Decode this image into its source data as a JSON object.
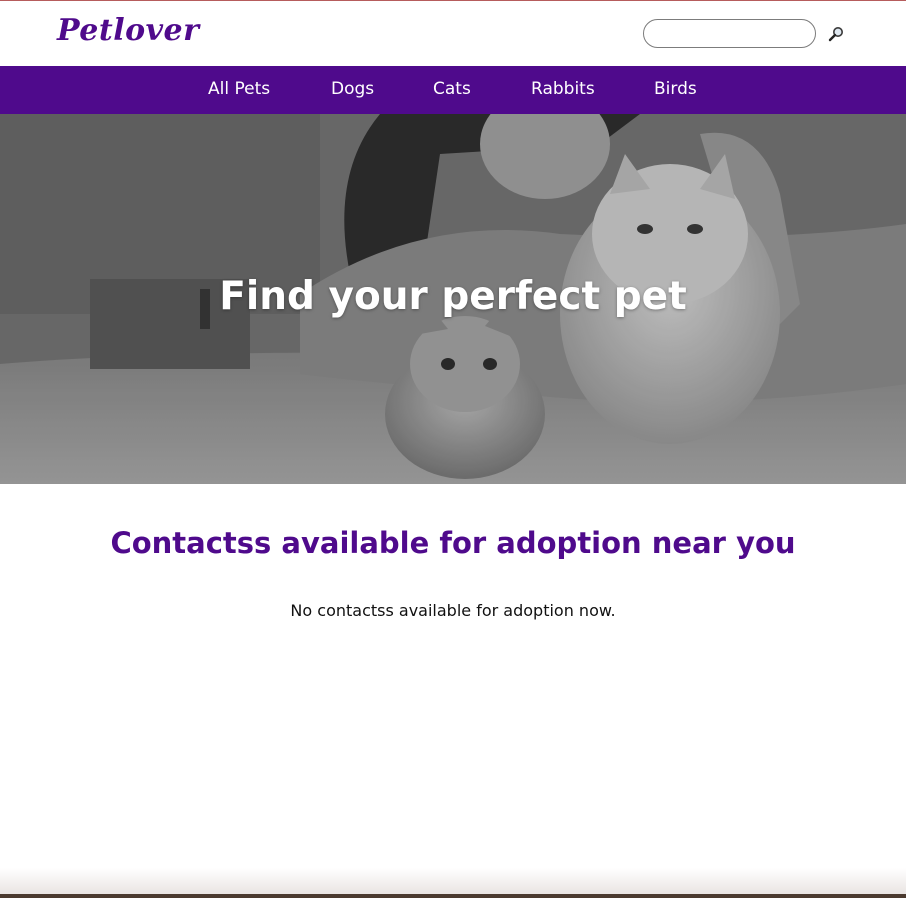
{
  "header": {
    "logo": "Petlover",
    "search": {
      "placeholder": "",
      "value": "",
      "button_icon": "magnifier-icon"
    }
  },
  "nav": {
    "items": [
      {
        "label": "All Pets"
      },
      {
        "label": "Dogs"
      },
      {
        "label": "Cats"
      },
      {
        "label": "Rabbits"
      },
      {
        "label": "Birds"
      }
    ]
  },
  "hero": {
    "title": "Find your perfect pet",
    "image_content": "grayscale photo of a girl lying on a bed with two fluffy cats"
  },
  "main": {
    "heading": "Contactss available for adoption near you",
    "empty_message": "No contactss available for adoption now."
  },
  "colors": {
    "brand": "#4f0a8c",
    "nav_text": "#ffffff",
    "hero_text": "#ffffff"
  }
}
